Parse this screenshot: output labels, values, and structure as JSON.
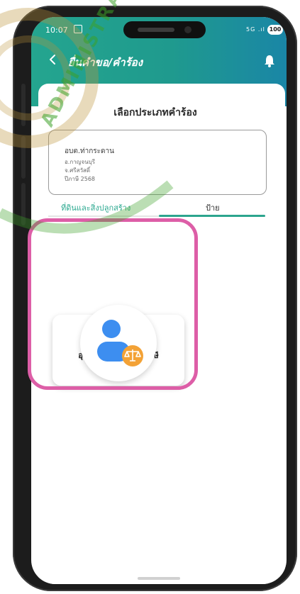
{
  "status_bar": {
    "time": "10:07",
    "signal": "5G .ıl",
    "battery": "100"
  },
  "header": {
    "title": "ยื่นคำขอ/คำร้อง"
  },
  "card": {
    "title": "เลือกประเภทคำร้อง"
  },
  "agency": {
    "name": "อบต.ท่ากระดาน",
    "district": "อ.กาญจนบุรี",
    "province": "จ.ศรีสวัสดิ์",
    "year": "ปีภาษี 2568"
  },
  "tabs": [
    {
      "label": "ที่ดินและสิ่งปลูกสร้าง",
      "active": false
    },
    {
      "label": "ป้าย",
      "active": true
    }
  ],
  "services": [
    {
      "label": "อุทธรณ์การประเมินภาษี",
      "icon": "person-scale-icon"
    }
  ],
  "watermark": {
    "text": "ADMINISTRATION"
  },
  "colors": {
    "header_teal": "#24a58f",
    "tab_active": "#2ca58e",
    "highlight_pink": "#dd5ea7",
    "icon_blue": "#3d8ef0",
    "icon_orange": "#f3a236"
  }
}
